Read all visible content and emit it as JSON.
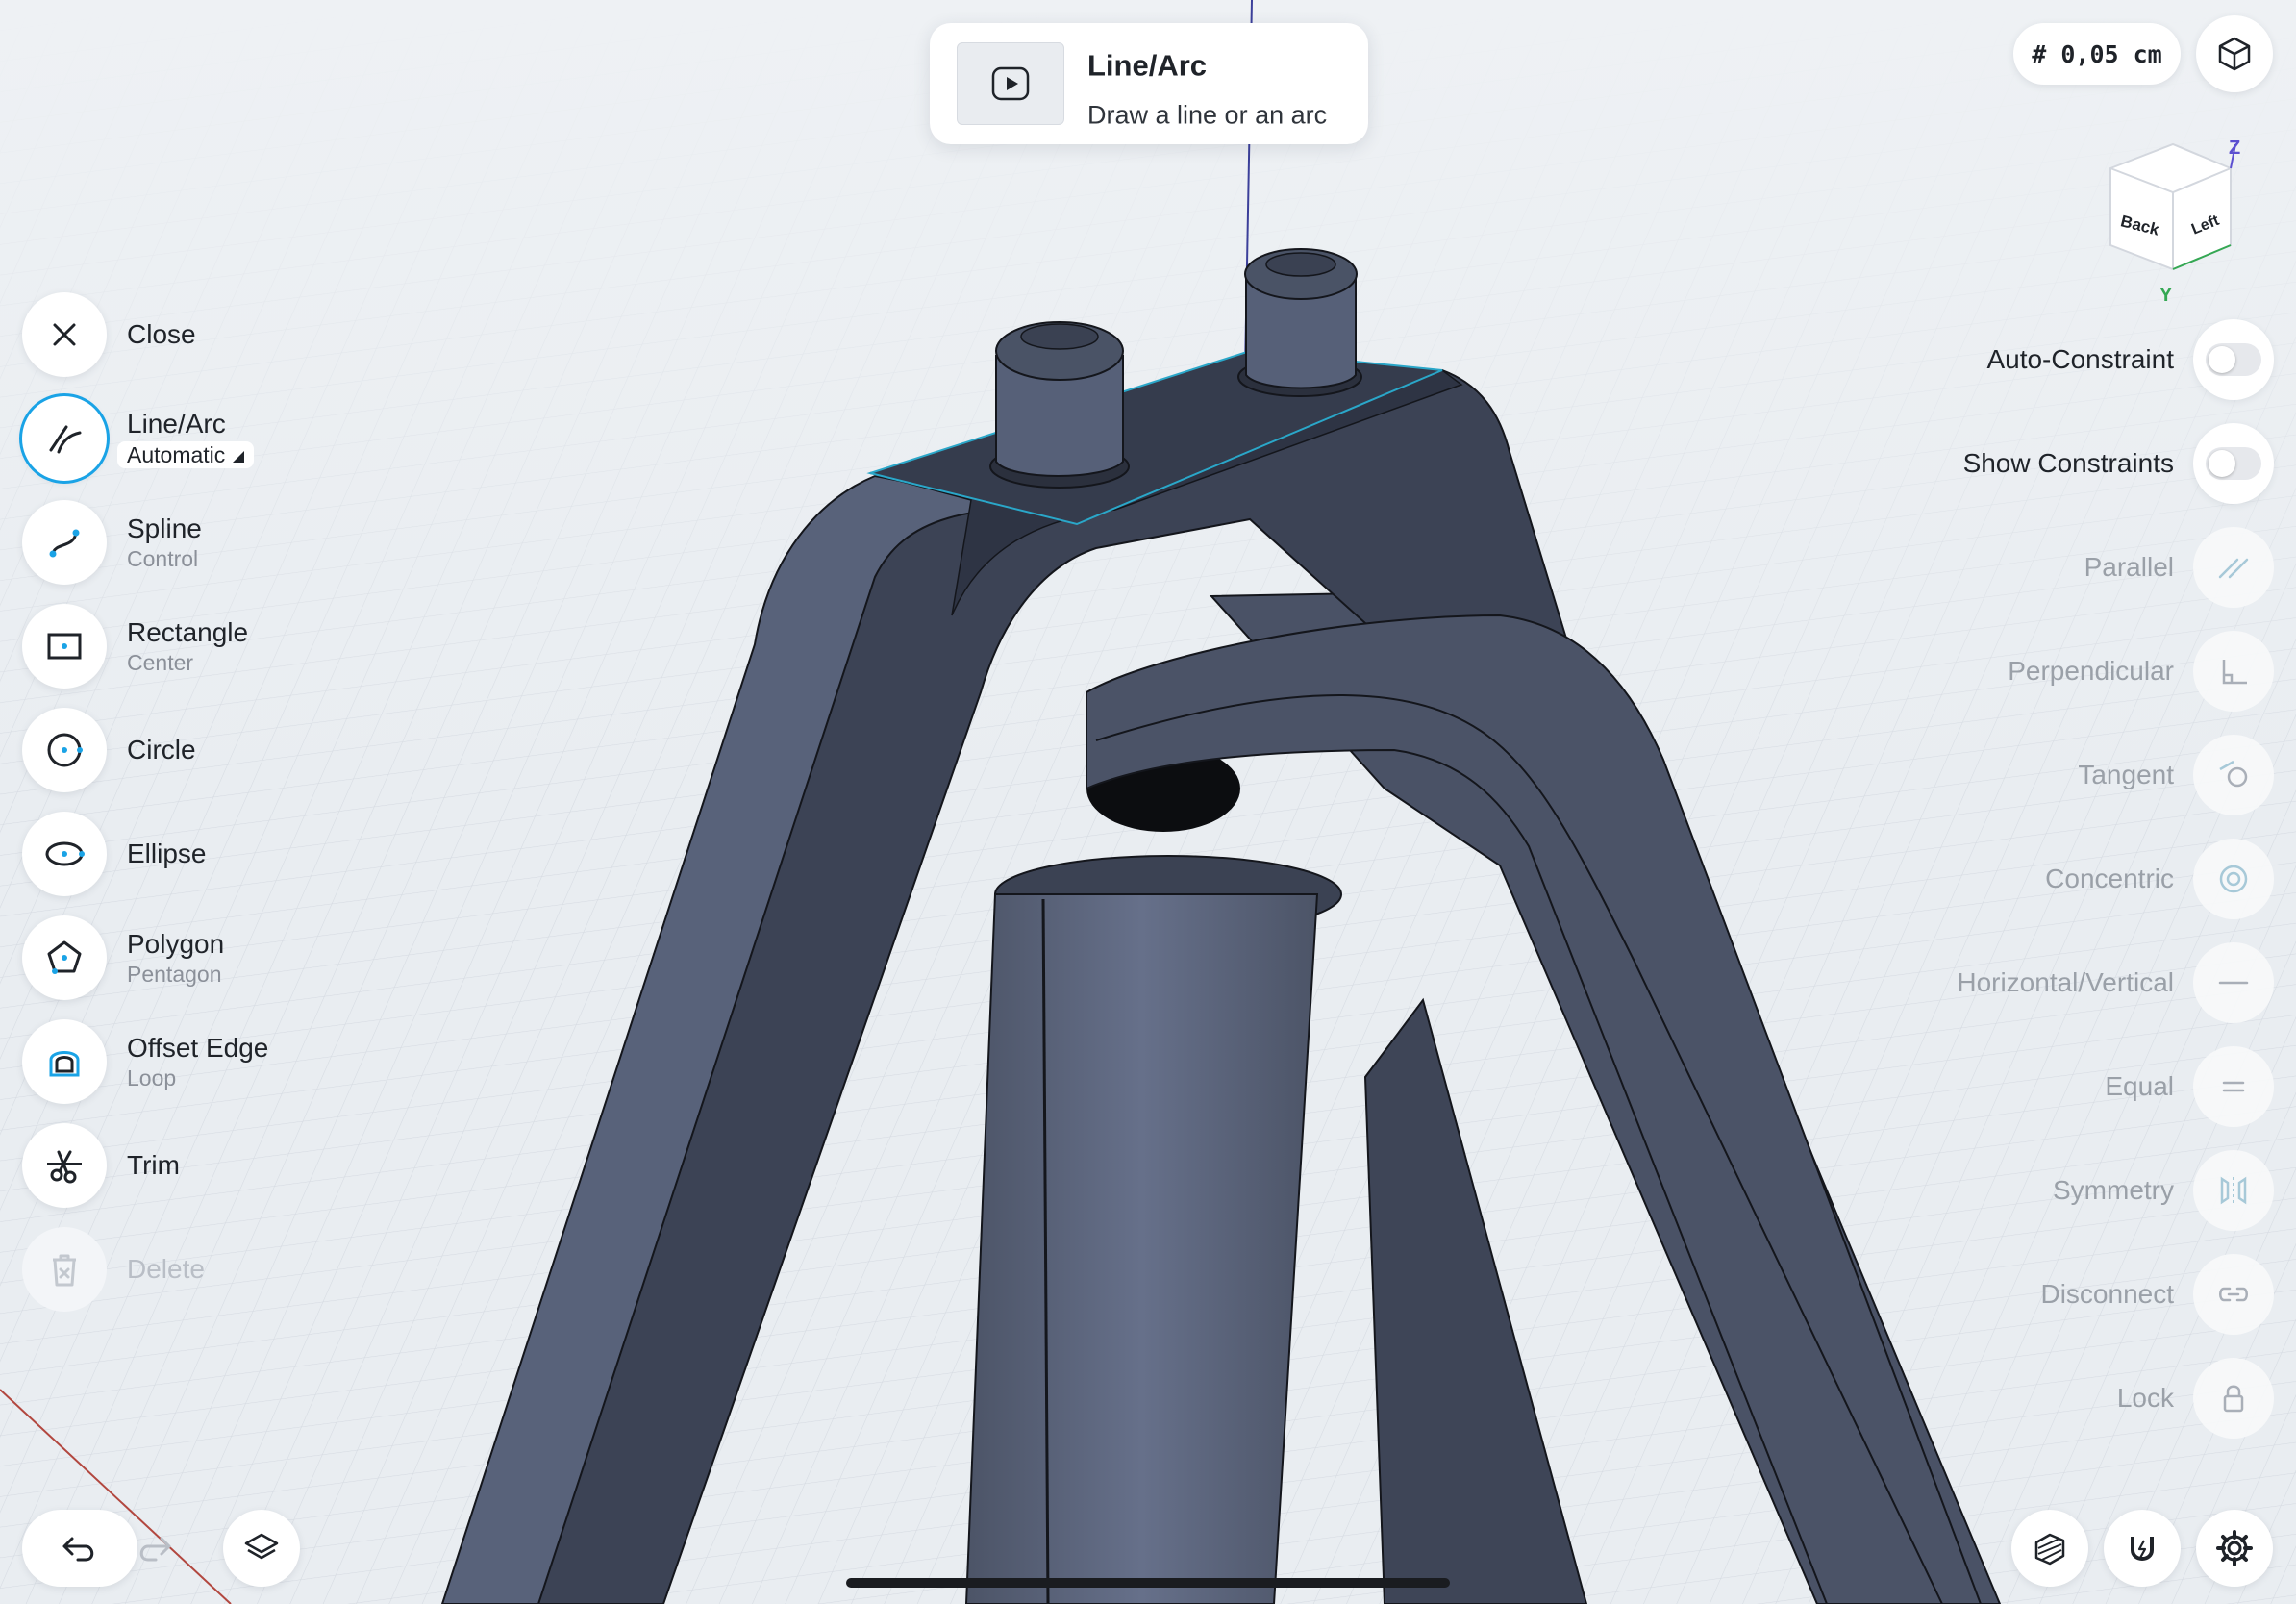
{
  "toast": {
    "title": "Line/Arc",
    "subtitle": "Draw a line or an arc"
  },
  "grid_size": "# 0,05 cm",
  "view_cube": {
    "faces": [
      "Back",
      "Left"
    ],
    "axes": [
      "Z",
      "Y"
    ]
  },
  "tools": [
    {
      "label": "Close",
      "sub": "",
      "icon": "close-icon"
    },
    {
      "label": "Line/Arc",
      "sub": "Automatic",
      "icon": "line-arc-icon",
      "active": true
    },
    {
      "label": "Spline",
      "sub": "Control",
      "icon": "spline-icon"
    },
    {
      "label": "Rectangle",
      "sub": "Center",
      "icon": "rectangle-icon"
    },
    {
      "label": "Circle",
      "sub": "",
      "icon": "circle-icon"
    },
    {
      "label": "Ellipse",
      "sub": "",
      "icon": "ellipse-icon"
    },
    {
      "label": "Polygon",
      "sub": "Pentagon",
      "icon": "polygon-icon"
    },
    {
      "label": "Offset Edge",
      "sub": "Loop",
      "icon": "offset-edge-icon"
    },
    {
      "label": "Trim",
      "sub": "",
      "icon": "trim-icon"
    },
    {
      "label": "Delete",
      "sub": "",
      "icon": "delete-icon",
      "disabled": true
    }
  ],
  "constraints": [
    {
      "label": "Auto-Constraint",
      "control": "toggle",
      "on": false
    },
    {
      "label": "Show Constraints",
      "control": "toggle",
      "on": false
    },
    {
      "label": "Parallel",
      "icon": "parallel-icon"
    },
    {
      "label": "Perpendicular",
      "icon": "perpendicular-icon"
    },
    {
      "label": "Tangent",
      "icon": "tangent-icon"
    },
    {
      "label": "Concentric",
      "icon": "concentric-icon"
    },
    {
      "label": "Horizontal/Vertical",
      "icon": "horizontal-vertical-icon"
    },
    {
      "label": "Equal",
      "icon": "equal-icon"
    },
    {
      "label": "Symmetry",
      "icon": "symmetry-icon"
    },
    {
      "label": "Disconnect",
      "icon": "disconnect-icon"
    },
    {
      "label": "Lock",
      "icon": "lock-icon"
    }
  ],
  "bottom_left": [
    "undo-icon",
    "redo-icon",
    "layers-icon"
  ],
  "bottom_right": [
    "section-view-icon",
    "snap-magnet-icon",
    "settings-gear-icon"
  ],
  "colors": {
    "accent": "#1aa3e6",
    "model": "#4a5266",
    "model_light": "#5a6278",
    "grid_bg": "#eceff3"
  }
}
